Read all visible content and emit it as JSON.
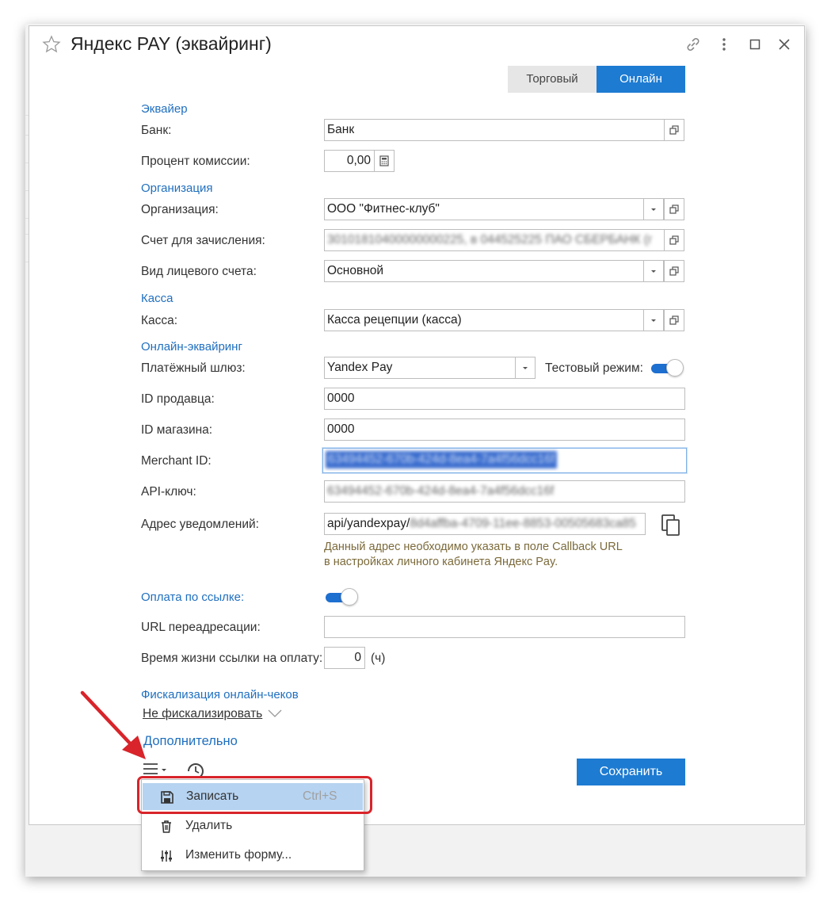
{
  "window": {
    "title": "Яндекс PAY (эквайринг)",
    "accent": "#1d7bd2",
    "tabs": [
      {
        "label": "Торговый",
        "active": false
      },
      {
        "label": "Онлайн",
        "active": true
      }
    ]
  },
  "sections": {
    "acquirer": "Эквайер",
    "organization": "Организация",
    "cashbox": "Касса",
    "online_acquiring": "Онлайн-эквайринг",
    "link_payment": "Оплата по ссылке:",
    "fiscalization": "Фискализация онлайн-чеков",
    "additional": "Дополнительно"
  },
  "fields": {
    "bank": {
      "label": "Банк:",
      "value": "Банк"
    },
    "commission": {
      "label": "Процент комиссии:",
      "value": "0,00"
    },
    "organization": {
      "label": "Организация:",
      "value": "ООО \"Фитнес-клуб\""
    },
    "account": {
      "label": "Счет для зачисления:",
      "value": "30101810400000000225, в 044525225 ПАО СБЕРБАНК (г"
    },
    "account_type": {
      "label": "Вид лицевого счета:",
      "value": "Основной"
    },
    "cashbox": {
      "label": "Касса:",
      "value": "Касса рецепции (касса)"
    },
    "gateway": {
      "label": "Платёжный шлюз:",
      "value": "Yandex Pay"
    },
    "test_mode": {
      "label": "Тестовый режим:",
      "on": true
    },
    "seller_id": {
      "label": "ID продавца:",
      "value": "0000"
    },
    "shop_id": {
      "label": "ID магазина:",
      "value": "0000"
    },
    "merchant_id": {
      "label": "Merchant ID:",
      "value": "63494452-670b-424d-8ea4-7a4f56dcc16f"
    },
    "api_key": {
      "label": "API-ключ:",
      "value": "63494452-670b-424d-8ea4-7a4f56dcc16f"
    },
    "notify_url": {
      "label": "Адрес уведомлений:",
      "value_prefix": "api/yandexpay/",
      "value_blur": "8d4affba-4709-11ee-8853-00505683ca85"
    },
    "notify_hint_1": "Данный адрес необходимо указать в поле Callback URL",
    "notify_hint_2": "в настройках личного кабинета Яндекс Pay.",
    "link_payment": {
      "on": true
    },
    "redirect_url": {
      "label": "URL переадресации:",
      "value": ""
    },
    "link_ttl": {
      "label": "Время жизни ссылки на оплату:",
      "value": "0",
      "unit": "(ч)"
    },
    "fiscal_mode": {
      "value": "Не фискализировать"
    }
  },
  "buttons": {
    "save": "Сохранить"
  },
  "menu": {
    "items": [
      {
        "label": "Записать",
        "shortcut": "Ctrl+S",
        "icon": "floppy-disk-icon",
        "highlighted": true
      },
      {
        "label": "Удалить",
        "shortcut": "",
        "icon": "trash-icon"
      },
      {
        "label": "Изменить форму...",
        "shortcut": "",
        "icon": "sliders-icon"
      }
    ]
  }
}
